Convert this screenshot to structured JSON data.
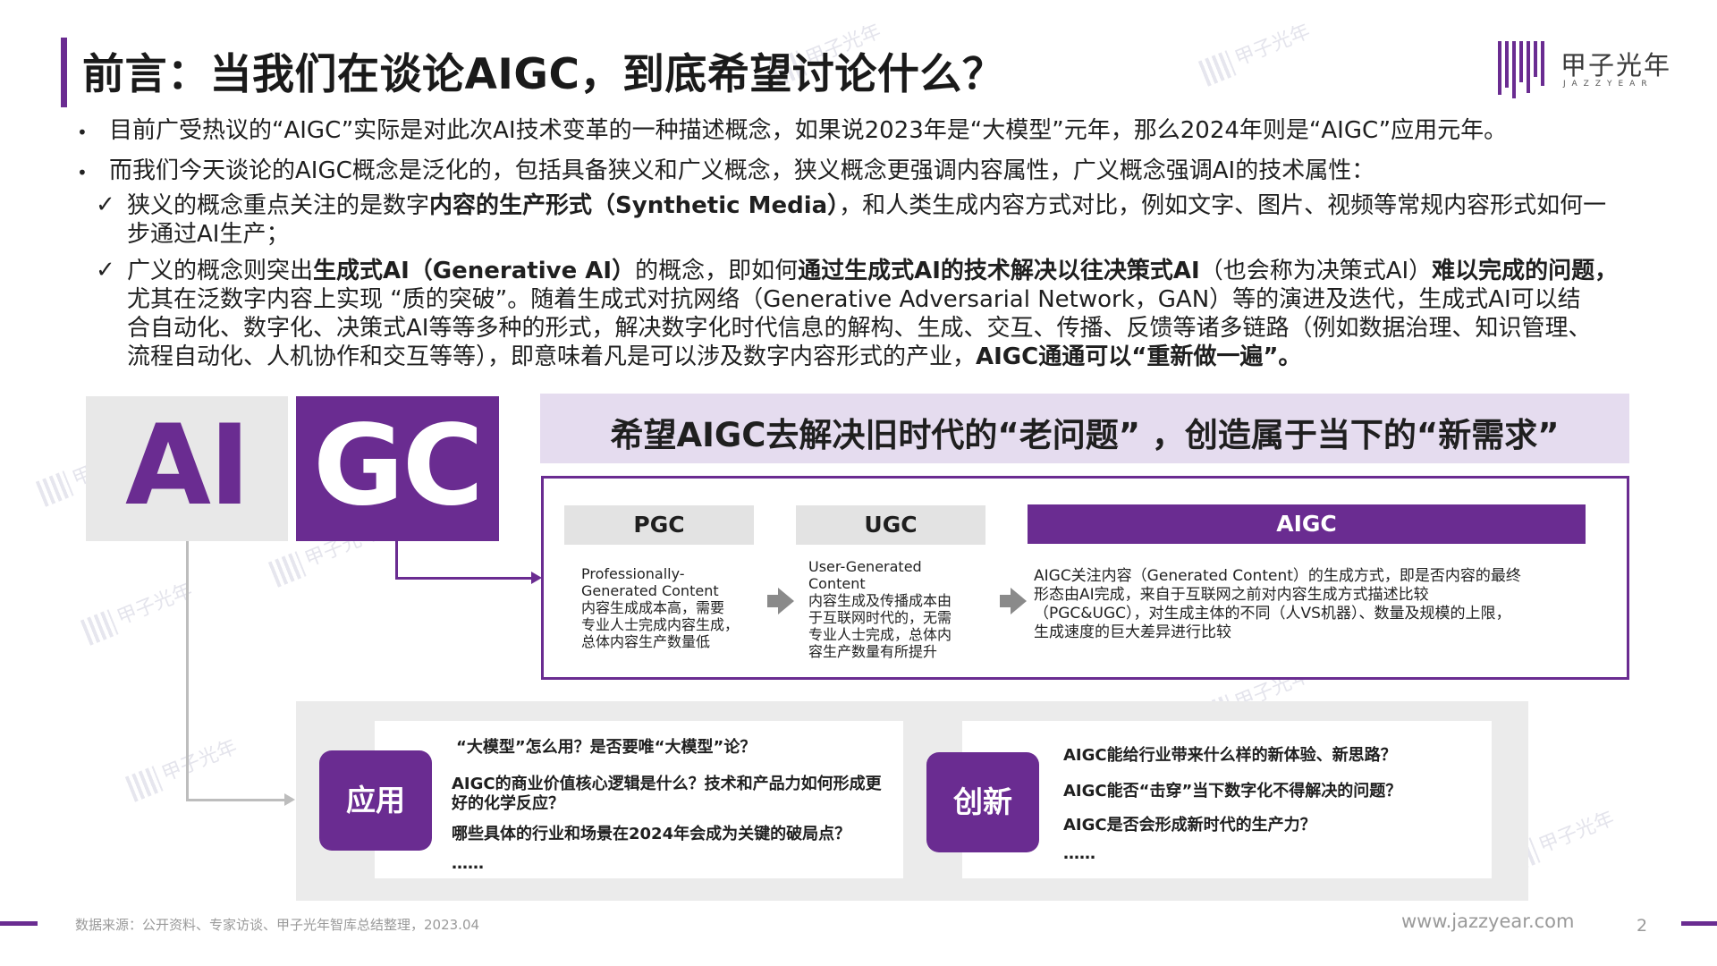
{
  "header": {
    "title": "前言：当我们在谈论AIGC，到底希望讨论什么？",
    "logo_cn": "甲子光年",
    "logo_en": "JAZZYEAR"
  },
  "watermark": "甲子光年",
  "intro": {
    "bullet1": "目前广受热议的“AIGC”实际是对此次AI技术变革的一种描述概念，如果说2023年是“大模型”元年，那么2024年则是“AIGC”应用元年。",
    "bullet2": "而我们今天谈论的AIGC概念是泛化的，包括具备狭义和广义概念，狭义概念更强调内容属性，广义概念强调AI的技术属性："
  },
  "narrow": {
    "p1": "狭义的概念重点关注的是数字",
    "b1": "内容的生产形式（Synthetic Media）",
    "p2": "，和人类生成内容方式对比，例如文字、图片、视频等常规内容形式如何一",
    "line2": "步通过AI生产；"
  },
  "broad": {
    "p1": "广义的概念则突出",
    "b1": "生成式AI（Generative AI）",
    "p2": "的概念，即如何",
    "b2": "通过生成式AI的技术解决以往决策式AI",
    "p3": "（也会称为决策式AI）",
    "b3": "难以完成的问题，",
    "line2": "尤其在泛数字内容上实现 “质的突破”。随着生成式对抗网络（Generative Adversarial Network，GAN）等的演进及迭代，生成式AI可以结",
    "line3": "合自动化、数字化、决策式AI等等多种的形式，解决数字化时代信息的解构、生成、交互、传播、反馈等诸多链路（例如数据治理、知识管理、",
    "line4a": "流程自动化、人机协作和交互等等），即意味着凡是可以涉及数字内容形式的产业，",
    "line4b": "AIGC通通可以“重新做一遍”。"
  },
  "logo_blocks": {
    "left": "AI",
    "right": "GC"
  },
  "hope": "希望AIGC去解决旧时代的“老问题” ，创造属于当下的“新需求”",
  "compare": {
    "pgc": {
      "label": "PGC",
      "lines": [
        "Professionally-",
        "Generated Content",
        "内容生成成本高，需要",
        "专业人士完成内容生成，",
        "总体内容生产数量低"
      ]
    },
    "ugc": {
      "label": "UGC",
      "lines": [
        "User-Generated",
        "Content",
        "内容生成及传播成本由",
        "于互联网时代的，无需",
        "专业人士完成，总体内",
        "容生产数量有所提升"
      ]
    },
    "aigc": {
      "label": "AIGC",
      "lines": [
        "AIGC关注内容（Generated Content）的生成方式，即是否内容的最终",
        "形态由AI完成，来自于互联网之前对内容生成方式描述比较",
        "（PGC&UGC），对生成主体的不同（人VS机器）、数量及规模的上限，",
        "生成速度的巨大差异进行比较"
      ]
    }
  },
  "application": {
    "label": "应用",
    "questions": [
      "“大模型”怎么用？是否要唯“大模型”论？",
      "AIGC的商业价值核心逻辑是什么？技术和产品力如何形成更",
      "好的化学反应？",
      "哪些具体的行业和场景在2024年会成为关键的破局点？",
      "……"
    ]
  },
  "innovation": {
    "label": "创新",
    "questions": [
      "AIGC能给行业带来什么样的新体验、新思路？",
      "AIGC能否“击穿”当下数字化不得解决的问题？",
      "AIGC是否会形成新时代的生产力？",
      "……"
    ]
  },
  "footer": {
    "source": "数据来源：公开资料、专家访谈、甲子光年智库总结整理，2023.04",
    "url": "www.jazzyear.com",
    "page": "2"
  },
  "colors": {
    "accent": "#6a2c91",
    "light_accent": "#e5dcef",
    "gray_block": "#e8e8e8"
  }
}
